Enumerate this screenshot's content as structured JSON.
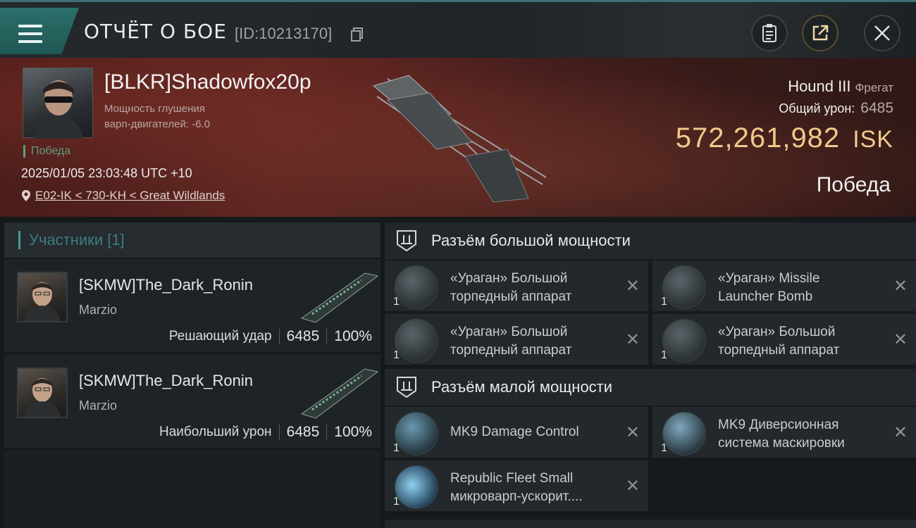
{
  "header": {
    "title": "ОТЧЁТ О БОЕ",
    "report_id": "[ID:10213170]"
  },
  "victim": {
    "pilot": "[BLKR]Shadowfox20p",
    "jam_line1": "Мощность глушения",
    "jam_line2": "варп-двигателей: -6.0",
    "outcome_tag": "Победа",
    "datetime": "2025/01/05 23:03:48 UTC +10",
    "location": "E02-IK < 730-KH < Great Wildlands",
    "ship_name": "Hound III",
    "ship_class": "Фрегат",
    "total_damage_label": "Общий урон:",
    "total_damage": "6485",
    "isk_value": "572,261,982",
    "isk_unit": "ISK",
    "result": "Победа"
  },
  "participants": {
    "title": "Участники [1]",
    "items": [
      {
        "name": "[SKMW]The_Dark_Ronin",
        "corp": "Marzio",
        "label": "Решающий удар",
        "damage": "6485",
        "percent": "100%"
      },
      {
        "name": "[SKMW]The_Dark_Ronin",
        "corp": "Marzio",
        "label": "Наибольший урон",
        "damage": "6485",
        "percent": "100%"
      }
    ]
  },
  "slots": {
    "high": {
      "title": "Разъём большой мощности",
      "items": [
        {
          "line1": "«Ураган» Большой",
          "line2": "торпедный аппарат",
          "qty": "1"
        },
        {
          "line1": "«Ураган» Missile",
          "line2": "Launcher Bomb",
          "qty": "1"
        },
        {
          "line1": "«Ураган» Большой",
          "line2": "торпедный аппарат",
          "qty": "1"
        },
        {
          "line1": "«Ураган» Большой",
          "line2": "торпедный аппарат",
          "qty": "1"
        }
      ]
    },
    "low": {
      "title": "Разъём малой мощности",
      "items": [
        {
          "line1": "MK9 Damage Control",
          "line2": "",
          "qty": "1"
        },
        {
          "line1": "MK9 Диверсионная",
          "line2": "система маскировки",
          "qty": "1"
        },
        {
          "line1": "Republic Fleet Small",
          "line2": "микроварп-ускорит....",
          "qty": "1"
        }
      ]
    }
  },
  "icons": {
    "menu": "menu-icon",
    "copy": "copy-icon",
    "clipboard": "clipboard-icon",
    "share": "share-icon",
    "close": "close-icon",
    "location": "location-pin-icon",
    "slot": "slot-icon",
    "remove": "close-icon"
  },
  "colors": {
    "accent_teal": "#2c6f6a",
    "isk_gold": "#f2c98a",
    "victory_green": "#5aa07a"
  }
}
